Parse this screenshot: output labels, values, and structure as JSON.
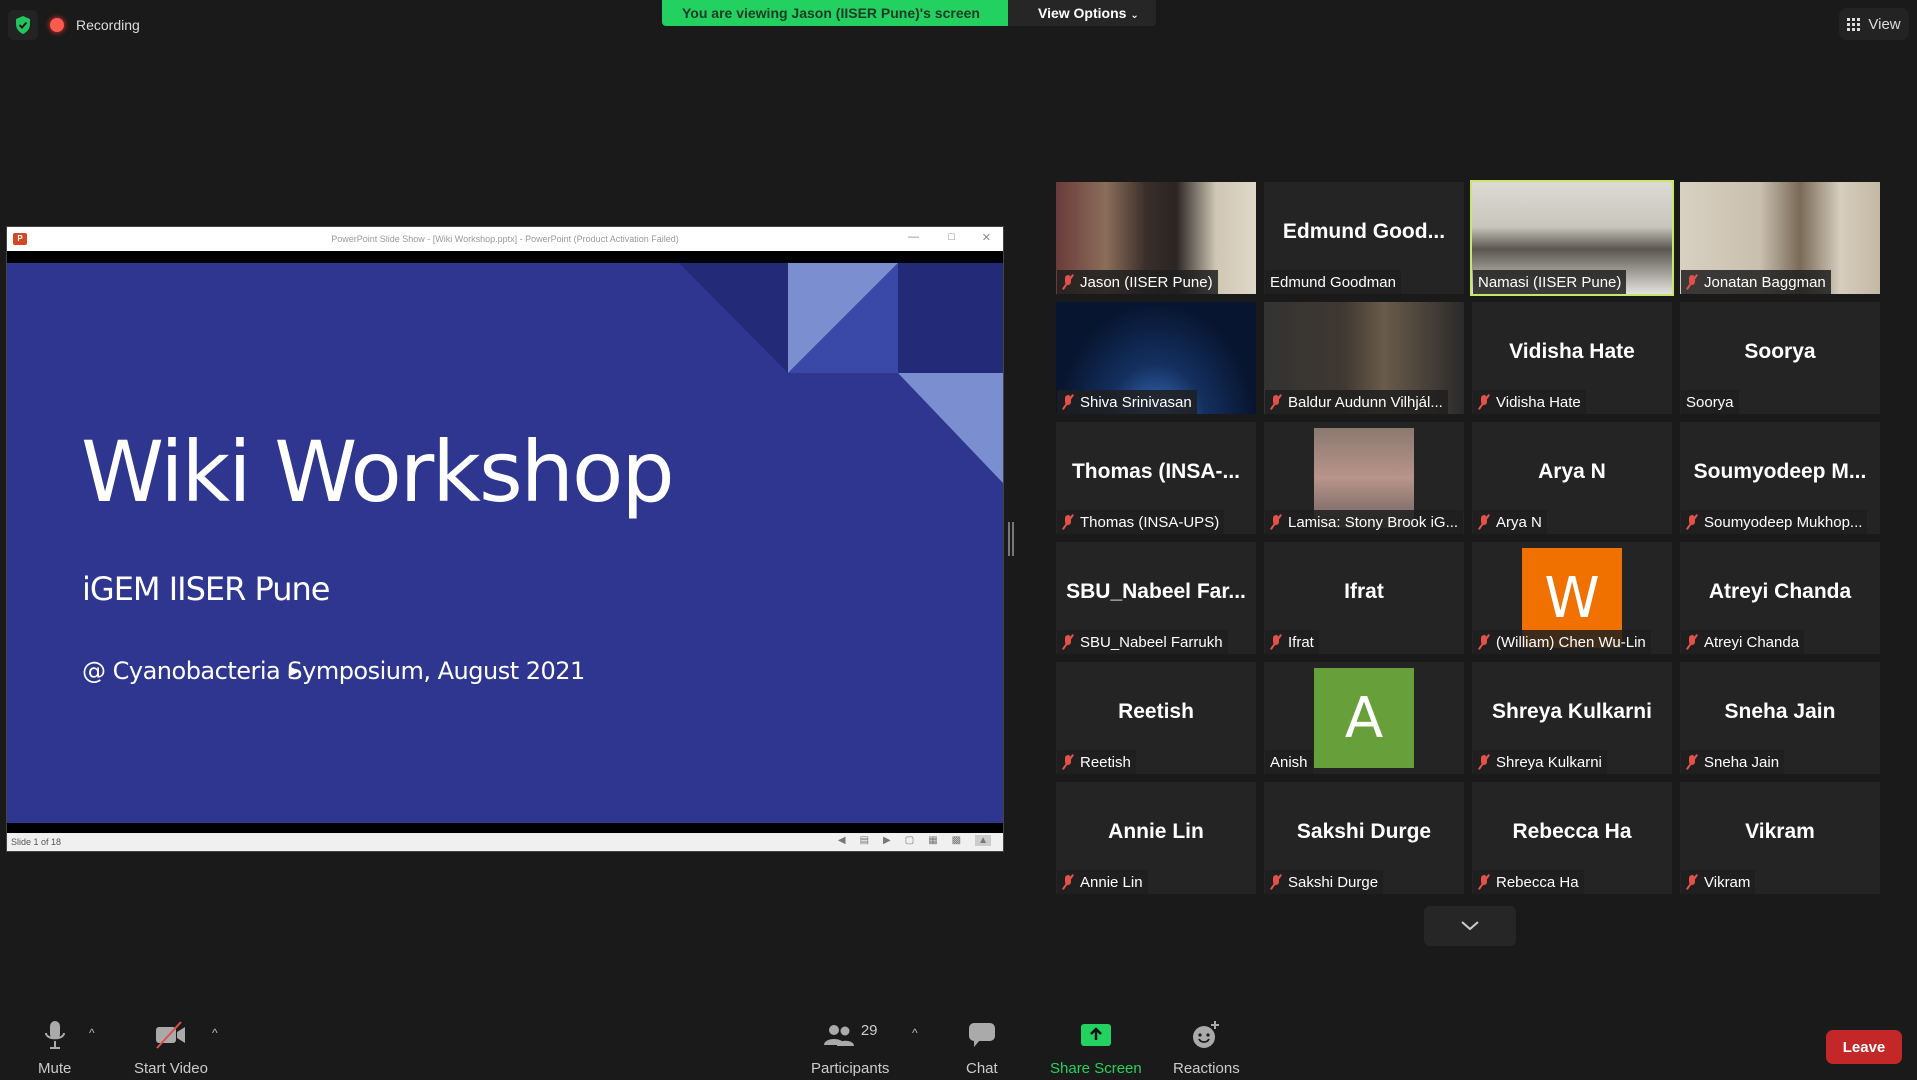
{
  "top_bar": {
    "security_icon": "shield-check-icon",
    "recording_label": "Recording",
    "viewing_banner": "You are viewing Jason (IISER Pune)'s screen",
    "view_options_label": "View Options",
    "view_label": "View"
  },
  "shared_screen": {
    "window_title": "PowerPoint Slide Show - [Wiki Workshop.pptx] - PowerPoint (Product Activation Failed)",
    "app_logo": "P",
    "slide": {
      "title": "Wiki Workshop",
      "subtitle": "iGEM IISER Pune",
      "event": "@ Cyanobacteria Symposium, August 2021"
    },
    "status": "Slide 1 of 18",
    "colors": {
      "slide_bg": "#2e3690",
      "accent_light": "#7b8fd0",
      "accent_dark": "#232a78",
      "accent_mid": "#3a48a8"
    }
  },
  "participants": [
    {
      "display": "video",
      "tile_name": "",
      "label": "Jason (IISER Pune)",
      "muted": true
    },
    {
      "display": "name",
      "tile_name": "Edmund Good...",
      "label": "Edmund Goodman",
      "muted": false
    },
    {
      "display": "video",
      "tile_name": "",
      "label": "Namasi (IISER Pune)",
      "muted": false,
      "active_speaker": true
    },
    {
      "display": "video",
      "tile_name": "",
      "label": "Jonatan Baggman",
      "muted": true
    },
    {
      "display": "video",
      "tile_name": "",
      "label": "Shiva Srinivasan",
      "muted": true
    },
    {
      "display": "video",
      "tile_name": "",
      "label": "Baldur Audunn Vilhjál...",
      "muted": true
    },
    {
      "display": "name",
      "tile_name": "Vidisha Hate",
      "label": "Vidisha Hate",
      "muted": true
    },
    {
      "display": "name",
      "tile_name": "Soorya",
      "label": "Soorya",
      "muted": false
    },
    {
      "display": "name",
      "tile_name": "Thomas  (INSA-...",
      "label": "Thomas (INSA-UPS)",
      "muted": true
    },
    {
      "display": "photo",
      "tile_name": "",
      "label": "Lamisa: Stony Brook iG...",
      "muted": true
    },
    {
      "display": "name",
      "tile_name": "Arya N",
      "label": "Arya N",
      "muted": true
    },
    {
      "display": "name",
      "tile_name": "Soumyodeep  M...",
      "label": "Soumyodeep Mukhop...",
      "muted": true
    },
    {
      "display": "name",
      "tile_name": "SBU_Nabeel  Far...",
      "label": "SBU_Nabeel Farrukh",
      "muted": true
    },
    {
      "display": "name",
      "tile_name": "Ifrat",
      "label": "Ifrat",
      "muted": true
    },
    {
      "display": "avatar",
      "avatar_letter": "W",
      "avatar_color": "#f07000",
      "label": "(William) Chen Wu-Lin",
      "muted": true
    },
    {
      "display": "name",
      "tile_name": "Atreyi Chanda",
      "label": "Atreyi Chanda",
      "muted": true
    },
    {
      "display": "name",
      "tile_name": "Reetish",
      "label": "Reetish",
      "muted": true
    },
    {
      "display": "avatar",
      "avatar_letter": "A",
      "avatar_color": "#67a03a",
      "label": "Anish",
      "muted": false
    },
    {
      "display": "name",
      "tile_name": "Shreya Kulkarni",
      "label": "Shreya Kulkarni",
      "muted": true
    },
    {
      "display": "name",
      "tile_name": "Sneha Jain",
      "label": "Sneha Jain",
      "muted": true
    },
    {
      "display": "name",
      "tile_name": "Annie Lin",
      "label": "Annie Lin",
      "muted": true
    },
    {
      "display": "name",
      "tile_name": "Sakshi Durge",
      "label": "Sakshi Durge",
      "muted": true
    },
    {
      "display": "name",
      "tile_name": "Rebecca Ha",
      "label": "Rebecca Ha",
      "muted": true
    },
    {
      "display": "name",
      "tile_name": "Vikram",
      "label": "Vikram",
      "muted": true
    }
  ],
  "toolbar": {
    "mute_label": "Mute",
    "start_video_label": "Start Video",
    "participants_label": "Participants",
    "participants_count": "29",
    "chat_label": "Chat",
    "share_screen_label": "Share Screen",
    "reactions_label": "Reactions",
    "leave_label": "Leave",
    "colors": {
      "share_green": "#23d160",
      "leave_red": "#c32727"
    }
  }
}
